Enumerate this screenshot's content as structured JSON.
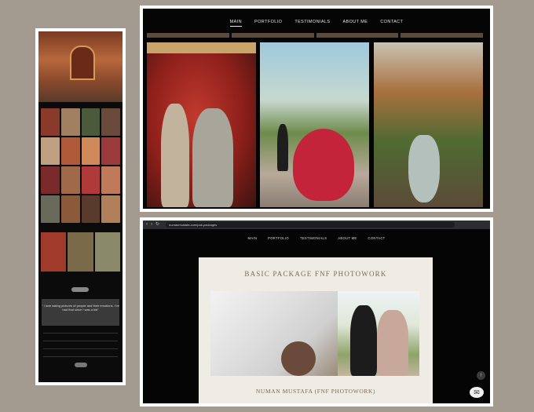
{
  "screens": {
    "top": {
      "nav": [
        "MAIN",
        "PORTFOLIO",
        "TESTIMONIALS",
        "ABOUT ME",
        "CONTACT"
      ],
      "active_nav": "MAIN"
    },
    "bottom": {
      "browser": {
        "url": "numanmustafa.com/pak-packages"
      },
      "nav": [
        "MAIN",
        "PORTFOLIO",
        "TESTIMONIALS",
        "ABOUT ME",
        "CONTACT"
      ],
      "card": {
        "title": "BASIC PACKAGE FNF PHOTOWORK",
        "subtitle": "NUMAN MUSTAFA (FNF PHOTOWORK)"
      },
      "scroll_top_icon": "arrow-up-icon",
      "chat_icon": "chat-bubble-icon"
    },
    "left": {
      "quote": "\" I love taking pictures of people and their emotions. I've had that since I was a kid\""
    }
  },
  "colors": {
    "background": "#a39a90",
    "page_dark": "#050505",
    "card_bg": "#efece6",
    "card_text": "#7a6a56"
  }
}
